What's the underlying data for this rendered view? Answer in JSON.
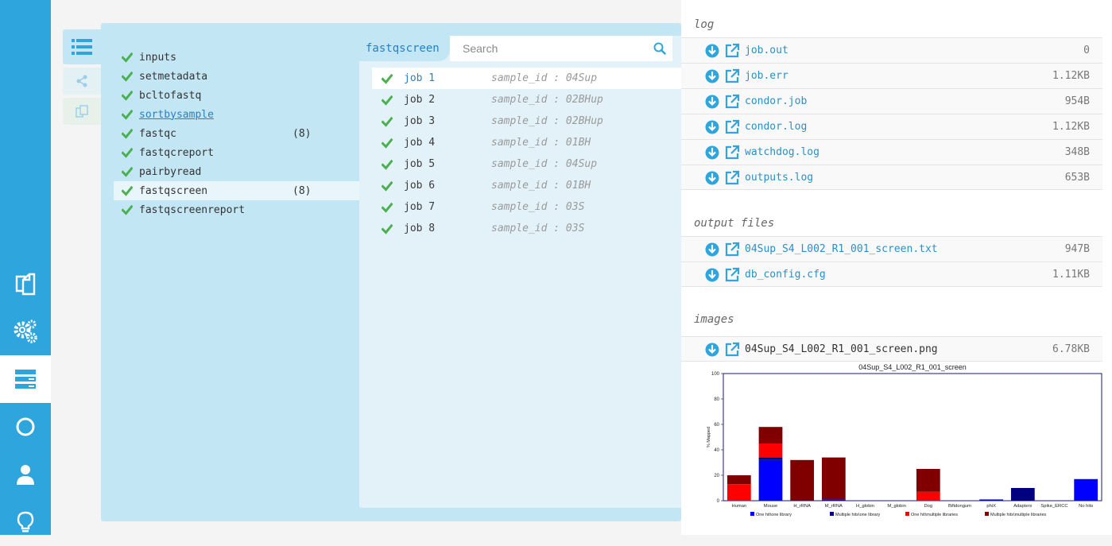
{
  "nav": {
    "items": [
      {
        "icon": "list-icon",
        "active": false
      },
      {
        "icon": "share-icon",
        "active": false
      },
      {
        "icon": "copy-icon",
        "active": false
      }
    ],
    "rail": [
      {
        "icon": "documents-icon"
      },
      {
        "icon": "gears-icon"
      },
      {
        "icon": "server-icon",
        "active": true
      },
      {
        "icon": "circle-icon"
      },
      {
        "icon": "user-icon"
      },
      {
        "icon": "lightbulb-icon"
      }
    ]
  },
  "steps": [
    {
      "label": "inputs",
      "count": ""
    },
    {
      "label": "setmetadata",
      "count": ""
    },
    {
      "label": "bcltofastq",
      "count": ""
    },
    {
      "label": "sortbysample",
      "count": "",
      "link": true
    },
    {
      "label": "fastqc",
      "count": "(8)"
    },
    {
      "label": "fastqcreport",
      "count": ""
    },
    {
      "label": "pairbyread",
      "count": ""
    },
    {
      "label": "fastqscreen",
      "count": "(8)",
      "selected": true
    },
    {
      "label": "fastqscreenreport",
      "count": ""
    }
  ],
  "jobs_panel": {
    "title": "fastqscreen",
    "search_placeholder": "Search"
  },
  "jobs": [
    {
      "label": "job 1",
      "sample": "sample_id : 04Sup"
    },
    {
      "label": "job 2",
      "sample": "sample_id : 02BHup"
    },
    {
      "label": "job 3",
      "sample": "sample_id : 02BHup"
    },
    {
      "label": "job 4",
      "sample": "sample_id : 01BH"
    },
    {
      "label": "job 5",
      "sample": "sample_id : 04Sup"
    },
    {
      "label": "job 6",
      "sample": "sample_id : 01BH"
    },
    {
      "label": "job 7",
      "sample": "sample_id : 03S"
    },
    {
      "label": "job 8",
      "sample": "sample_id : 03S"
    }
  ],
  "files": {
    "log_title": "log",
    "log": [
      {
        "name": "job.out",
        "size": "0"
      },
      {
        "name": "job.err",
        "size": "1.12KB"
      },
      {
        "name": "condor.job",
        "size": "954B"
      },
      {
        "name": "condor.log",
        "size": "1.12KB"
      },
      {
        "name": "watchdog.log",
        "size": "348B"
      },
      {
        "name": "outputs.log",
        "size": "653B"
      }
    ],
    "output_title": "output files",
    "output": [
      {
        "name": "04Sup_S4_L002_R1_001_screen.txt",
        "size": "947B"
      },
      {
        "name": "db_config.cfg",
        "size": "1.11KB"
      }
    ],
    "images_title": "images",
    "images": [
      {
        "name": "04Sup_S4_L002_R1_001_screen.png",
        "size": "6.78KB"
      }
    ]
  },
  "colors": {
    "rail": "#2ea6dd",
    "panel": "#c3e6f5",
    "check": "#4caf50",
    "link": "#2a8fc8"
  },
  "chart_data": {
    "type": "bar",
    "title": "04Sup_S4_L002_R1_001_screen",
    "ylabel": "% Mapped",
    "xlabel": "",
    "ylim": [
      0,
      100
    ],
    "yticks": [
      0,
      20,
      40,
      60,
      80,
      100
    ],
    "categories": [
      "Human",
      "Mouse",
      "H_rRNA",
      "M_rRNA",
      "H_globin",
      "M_globin",
      "Dog",
      "Bifidongum",
      "phiX",
      "Adapters",
      "Spike_ERCC",
      "No hits"
    ],
    "stacked": true,
    "series": [
      {
        "name": "One hit\\one library",
        "color": "#0000ff",
        "values": [
          0,
          32,
          0,
          1,
          0,
          0,
          0,
          0,
          1,
          0,
          0,
          17
        ]
      },
      {
        "name": "Multiple hits\\one library",
        "color": "#000080",
        "values": [
          0,
          2,
          0,
          0,
          0,
          0,
          0,
          0,
          0,
          10,
          0,
          0
        ]
      },
      {
        "name": "One hit\\multiple libraries",
        "color": "#ff0000",
        "values": [
          13,
          11,
          0,
          0,
          0,
          0,
          7,
          0,
          0,
          0,
          0,
          0
        ]
      },
      {
        "name": "Multiple hits\\multiple libraries",
        "color": "#800000",
        "values": [
          7,
          13,
          32,
          33,
          0,
          0,
          18,
          0,
          0,
          0,
          0,
          0
        ]
      }
    ],
    "grid": false,
    "legend": "bottom"
  }
}
